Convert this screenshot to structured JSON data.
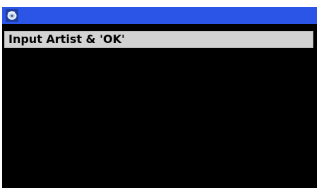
{
  "window": {
    "icon": "disc-player-icon"
  },
  "prompt": {
    "text": "Input Artist & 'OK'"
  },
  "colors": {
    "title_bar": "#2b55e6",
    "prompt_background": "#d2d2d2",
    "screen_background": "#000000"
  }
}
